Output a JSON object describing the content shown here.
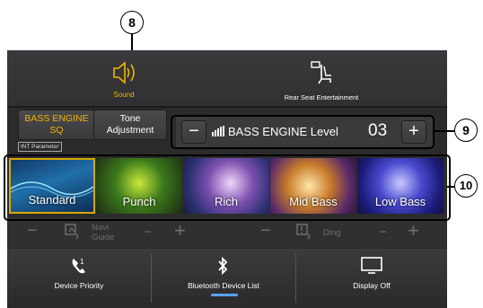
{
  "callouts": {
    "c8": "8",
    "c9": "9",
    "c10": "10"
  },
  "tabs": [
    {
      "label": "Sound",
      "icon": "speaker-icon",
      "active": true
    },
    {
      "label": "Rear Seat Entertainment",
      "icon": "rear-seat-icon",
      "active": false
    }
  ],
  "submenu": {
    "bass_engine_sq": "BASS ENGINE SQ",
    "tone_adjustment": "Tone Adjustment",
    "int_parameter": "INT Parameter"
  },
  "level": {
    "label": "BASS ENGINE Level",
    "value": "03",
    "minus": "−",
    "plus": "+"
  },
  "presets": [
    {
      "label": "Standard",
      "selected": true
    },
    {
      "label": "Punch",
      "selected": false
    },
    {
      "label": "Rich",
      "selected": false
    },
    {
      "label": "Mid Bass",
      "selected": false
    },
    {
      "label": "Low Bass",
      "selected": false
    }
  ],
  "faded_row": {
    "left_label": "Navi Guide",
    "right_label": "Ding",
    "minus": "−",
    "plus": "+"
  },
  "bottom": {
    "device_priority": "Device Priority",
    "bluetooth_list": "Bluetooth Device List",
    "display_off": "Display Off"
  },
  "colors": {
    "accent": "#f0b400",
    "background": "#2b2b2c",
    "selected_border": "#d8a800"
  }
}
